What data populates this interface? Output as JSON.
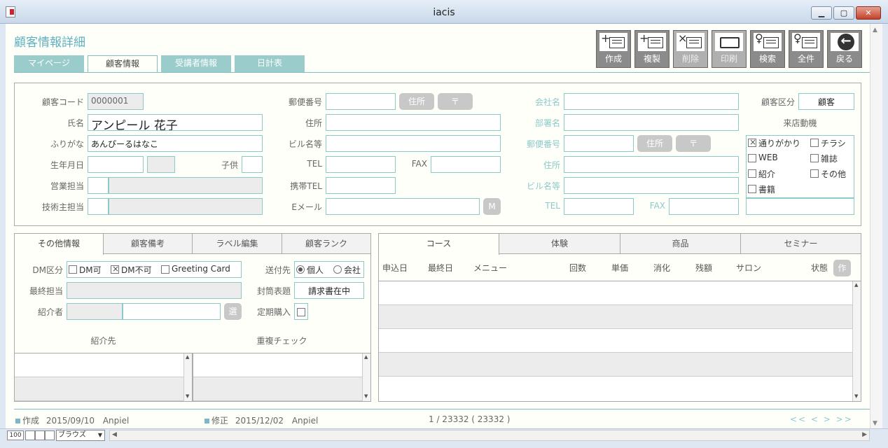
{
  "window": {
    "title": "iacis",
    "min": "▁",
    "max": "▢",
    "close": "✕"
  },
  "page_title": "顧客情報詳細",
  "tabs": [
    {
      "label": "マイページ"
    },
    {
      "label": "顧客情報"
    },
    {
      "label": "受講者情報"
    },
    {
      "label": "日計表"
    }
  ],
  "toolbar": [
    {
      "label": "作成",
      "icon": "plus-list-icon",
      "glyph": "+"
    },
    {
      "label": "複製",
      "icon": "duplicate-icon",
      "glyph": "+"
    },
    {
      "label": "削除",
      "icon": "delete-icon",
      "glyph": "×"
    },
    {
      "label": "印刷",
      "icon": "printer-icon",
      "glyph": ""
    },
    {
      "label": "検索",
      "icon": "search-icon",
      "glyph": "♀"
    },
    {
      "label": "全件",
      "icon": "all-records-icon",
      "glyph": "♀"
    },
    {
      "label": "戻る",
      "icon": "back-arrow-icon",
      "glyph": "←"
    }
  ],
  "customer": {
    "code_label": "顧客コード",
    "code": "0000001",
    "name_label": "氏名",
    "name": "アンピール 花子",
    "kana_label": "ふりがな",
    "kana": "あんぴーるはなこ",
    "birth_label": "生年月日",
    "birth": "",
    "age": "",
    "children_label": "子供",
    "children": "",
    "sales_label": "営業担当",
    "tech_label": "技術主担当"
  },
  "address": {
    "zip_label": "郵便番号",
    "zip": "",
    "addr_btn": "住所",
    "zip_btn": "〒",
    "addr_label": "住所",
    "bldg_label": "ビル名等",
    "tel_label": "TEL",
    "fax_label": "FAX",
    "mobile_label": "携帯TEL",
    "email_label": "Eメール",
    "mail_btn": "M"
  },
  "company": {
    "name_label": "会社名",
    "dept_label": "部署名",
    "zip_label": "郵便番号",
    "addr_btn": "住所",
    "zip_btn": "〒",
    "addr_label": "住所",
    "bldg_label": "ビル名等",
    "tel_label": "TEL",
    "fax_label": "FAX"
  },
  "category": {
    "label": "顧客区分",
    "value": "顧客",
    "visit_label": "来店動機",
    "motives": [
      {
        "label": "通りがかり",
        "checked": true
      },
      {
        "label": "チラシ",
        "checked": false
      },
      {
        "label": "WEB",
        "checked": false
      },
      {
        "label": "雑誌",
        "checked": false
      },
      {
        "label": "紹介",
        "checked": false
      },
      {
        "label": "その他",
        "checked": false
      },
      {
        "label": "書籍",
        "checked": false
      }
    ]
  },
  "subtabs_left": [
    {
      "label": "その他情報"
    },
    {
      "label": "顧客備考"
    },
    {
      "label": "ラベル編集"
    },
    {
      "label": "顧客ランク"
    }
  ],
  "other": {
    "dm_label": "DM区分",
    "dm_options": [
      {
        "label": "DM可",
        "checked": false
      },
      {
        "label": "DM不可",
        "checked": true
      },
      {
        "label": "Greeting Card",
        "checked": false
      }
    ],
    "send_label": "送付先",
    "send_options": [
      {
        "label": "個人",
        "checked": true
      },
      {
        "label": "会社",
        "checked": false
      }
    ],
    "last_staff_label": "最終担当",
    "envelope_label": "封筒表題",
    "envelope": "請求書在中",
    "referrer_label": "紹介者",
    "select_btn": "選",
    "regular_label": "定期購入",
    "referred_label": "紹介先",
    "dup_label": "重複チェック"
  },
  "subtabs_right": [
    {
      "label": "コース"
    },
    {
      "label": "体験"
    },
    {
      "label": "商品"
    },
    {
      "label": "セミナー"
    }
  ],
  "course_columns": [
    "申込日",
    "最終日",
    "メニュー",
    "回数",
    "単価",
    "消化",
    "残額",
    "サロン",
    "状態"
  ],
  "create_btn": "作",
  "footer": {
    "created_label": "作成",
    "created_date": "2015/09/10",
    "created_by": "Anpiel",
    "modified_label": "修正",
    "modified_date": "2015/12/02",
    "modified_by": "Anpiel",
    "record": "1 / 23332 ( 23332 )",
    "pager": "<<  <    >  >>"
  },
  "status": {
    "zoom": "100",
    "mode": "ブラウズ"
  }
}
